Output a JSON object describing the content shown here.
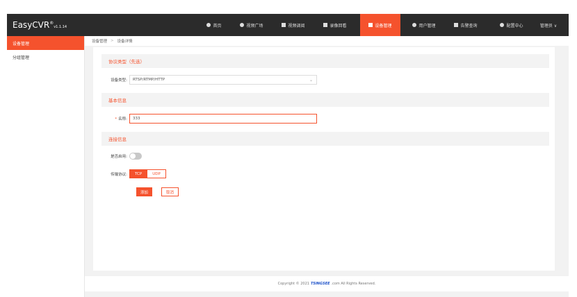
{
  "app": {
    "name": "EasyCVR",
    "reg": "®",
    "version": "v1.1.14"
  },
  "nav": {
    "items": [
      {
        "label": "首页"
      },
      {
        "label": "视频广场"
      },
      {
        "label": "视频调阅"
      },
      {
        "label": "录像回看"
      },
      {
        "label": "设备管理",
        "active": true
      },
      {
        "label": "用户管理"
      },
      {
        "label": "告警查询"
      },
      {
        "label": "配置中心"
      }
    ],
    "user": "管理员 ∨"
  },
  "sidebar": {
    "items": [
      {
        "label": "设备管理",
        "active": true
      },
      {
        "label": "分组管理"
      }
    ]
  },
  "breadcrumb": {
    "root": "设备管理",
    "sep": ">",
    "current": "设备详情"
  },
  "form": {
    "section_protocol": "协议类型（先选）",
    "device_type_label": "设备类型:",
    "device_type_value": "RTSP/RTMP/HTTP",
    "section_basic": "基本信息",
    "name_required": "*",
    "name_label": "名称:",
    "name_value": "333",
    "section_connect": "连接信息",
    "enable_label": "是否启用:",
    "enable_value": false,
    "transport_label": "传输协议:",
    "transport_options": [
      "TCP",
      "UDP"
    ],
    "transport_selected": "TCP",
    "add_label": "添加",
    "cancel_label": "取消"
  },
  "footer": {
    "prefix": "Copyright © 2021",
    "brand": "TSINGSEE",
    "suffix": ".com All Rights Reserved."
  },
  "colors": {
    "accent": "#f5522d",
    "topbar": "#2b2b2b"
  }
}
